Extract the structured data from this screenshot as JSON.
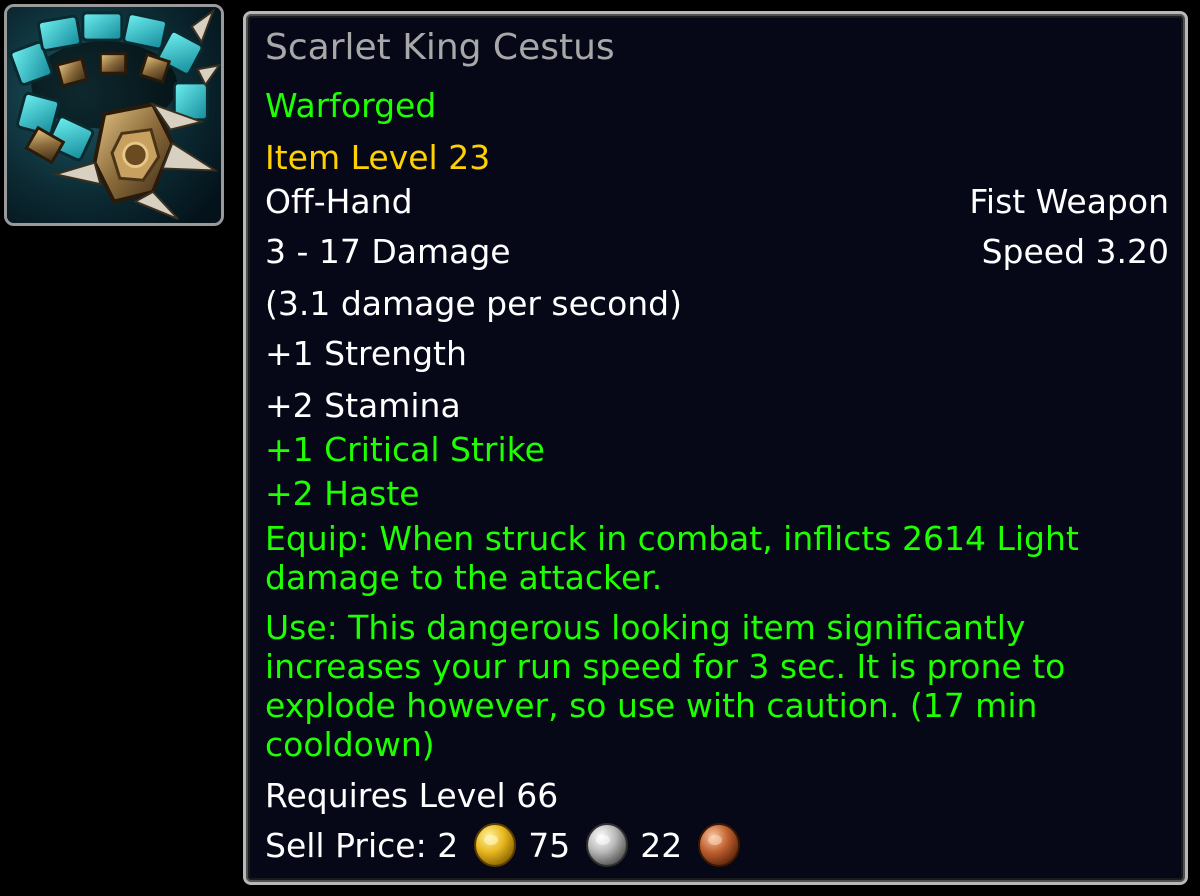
{
  "item": {
    "name": "Scarlet King Cestus",
    "tier": "Warforged",
    "item_level": "Item Level 23",
    "slot": "Off-Hand",
    "weapon_type": "Fist Weapon",
    "damage": "3 - 17 Damage",
    "speed": "Speed 3.20",
    "dps": "(3.1 damage per second)",
    "stats_white": [
      "+1 Strength",
      "+2 Stamina"
    ],
    "stats_green": [
      "+1 Critical Strike",
      "+2 Haste"
    ],
    "equip": "Equip: When struck in combat, inflicts 2614 Light damage to the attacker.",
    "use": "Use: This dangerous looking item significantly increases your run speed for 3 sec. It is prone to explode however, so use with caution. (17 min cooldown)",
    "requires": "Requires Level 66",
    "sell_label": "Sell Price:",
    "sell_gold": "2",
    "sell_silver": "75",
    "sell_copper": "22"
  },
  "icons": {
    "item_icon": "cestus-fist-weapon-icon",
    "gold": "gold-coin-icon",
    "silver": "silver-coin-icon",
    "copper": "copper-coin-icon"
  },
  "colors": {
    "name": "#a8a8a8",
    "green": "#1eff00",
    "gold_text": "#ffd100",
    "white": "#ffffff",
    "background": "#060818"
  }
}
